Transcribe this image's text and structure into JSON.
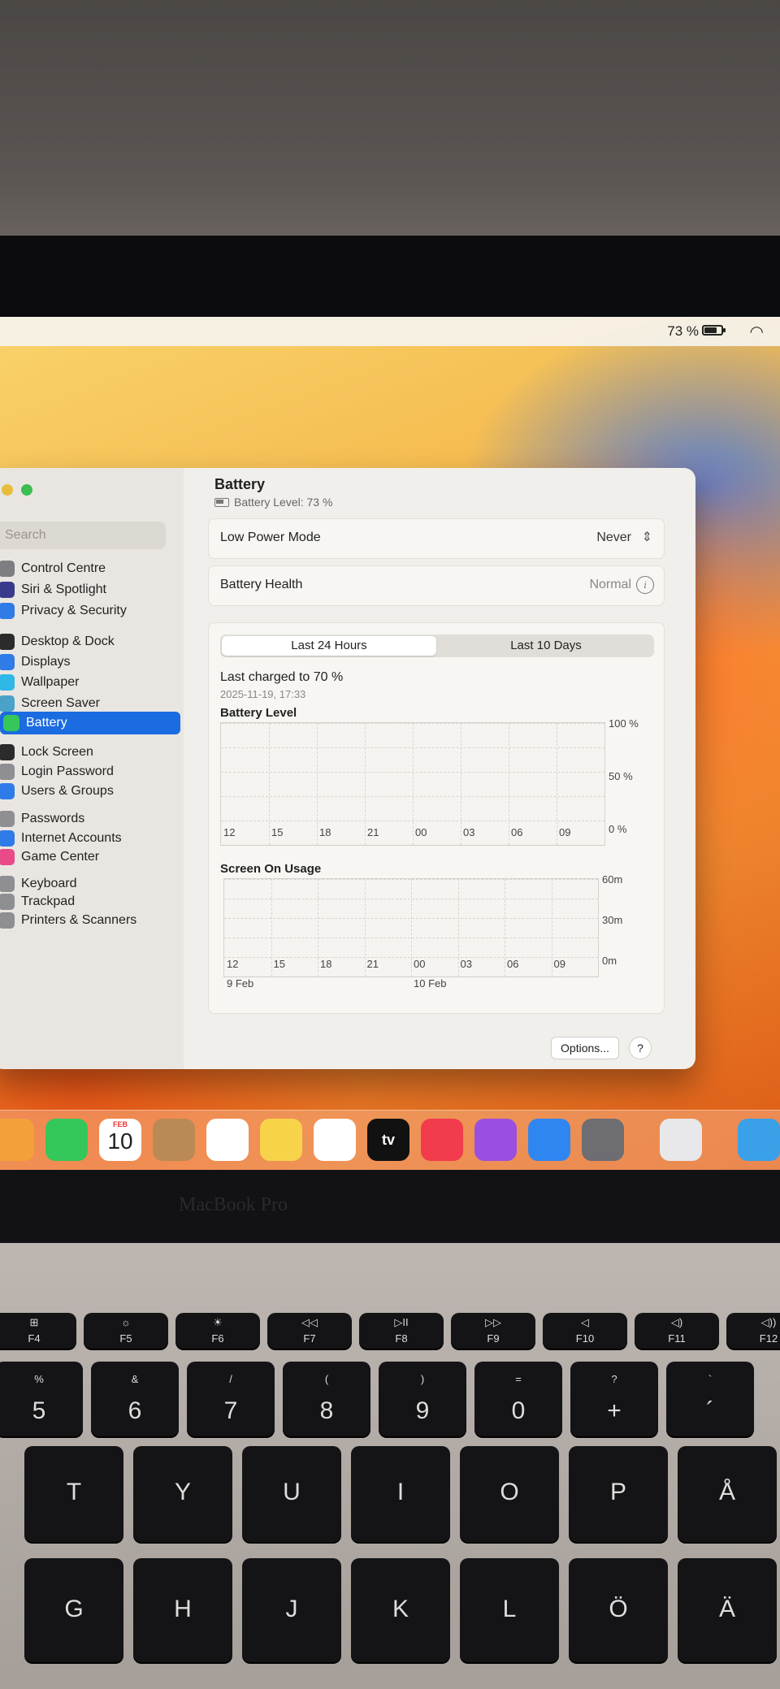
{
  "menubar": {
    "battery_percent": "73 %",
    "battery_icon": "battery-icon",
    "wifi_icon": "wifi-icon"
  },
  "sidebar": {
    "search_placeholder": "Search",
    "items": [
      {
        "label": "Control Centre",
        "icon": "control-centre-icon",
        "color": "#7d7d82"
      },
      {
        "label": "Siri & Spotlight",
        "icon": "siri-icon",
        "color": "#3a3a8c"
      },
      {
        "label": "Privacy & Security",
        "icon": "hand-icon",
        "color": "#2f7be8"
      },
      {
        "label": "Desktop & Dock",
        "icon": "dock-icon",
        "color": "#2b2b2b"
      },
      {
        "label": "Displays",
        "icon": "display-icon",
        "color": "#2f7be8"
      },
      {
        "label": "Wallpaper",
        "icon": "wallpaper-icon",
        "color": "#2fb7e8"
      },
      {
        "label": "Screen Saver",
        "icon": "screen-saver-icon",
        "color": "#49a3c9"
      },
      {
        "label": "Battery",
        "icon": "battery-icon",
        "color": "#35c759"
      },
      {
        "label": "Lock Screen",
        "icon": "lock-icon",
        "color": "#2b2b2b"
      },
      {
        "label": "Login Password",
        "icon": "key-icon",
        "color": "#8e8e93"
      },
      {
        "label": "Users & Groups",
        "icon": "users-icon",
        "color": "#2f7be8"
      },
      {
        "label": "Passwords",
        "icon": "key-icon",
        "color": "#8e8e93"
      },
      {
        "label": "Internet Accounts",
        "icon": "at-icon",
        "color": "#2f7be8"
      },
      {
        "label": "Game Center",
        "icon": "game-center-icon",
        "color": "#e84a8a"
      },
      {
        "label": "Keyboard",
        "icon": "keyboard-icon",
        "color": "#8e8e93"
      },
      {
        "label": "Trackpad",
        "icon": "trackpad-icon",
        "color": "#8e8e93"
      },
      {
        "label": "Printers & Scanners",
        "icon": "printer-icon",
        "color": "#8e8e93"
      }
    ]
  },
  "main": {
    "title": "Battery",
    "subtitle": "Battery Level: 73 %",
    "low_power_label": "Low Power Mode",
    "low_power_value": "Never",
    "health_label": "Battery Health",
    "health_value": "Normal",
    "tab_24h": "Last 24 Hours",
    "tab_10d": "Last 10 Days",
    "last_charged": "Last charged to 70 %",
    "last_charged_time": "2025-11-19, 17:33",
    "options_label": "Options...",
    "help_label": "?"
  },
  "chart_data": [
    {
      "type": "bar",
      "title": "Battery Level",
      "categories": [
        "12",
        "15",
        "18",
        "21",
        "00",
        "03",
        "06",
        "09"
      ],
      "y_ticks": [
        "100 %",
        "50 %",
        "0 %"
      ],
      "values": [],
      "ylim": [
        0,
        100
      ]
    },
    {
      "type": "bar",
      "title": "Screen On Usage",
      "categories": [
        "12",
        "15",
        "18",
        "21",
        "00",
        "03",
        "06",
        "09"
      ],
      "date_labels": [
        "9 Feb",
        "10 Feb"
      ],
      "y_ticks": [
        "60m",
        "30m",
        "0m"
      ],
      "values": [],
      "ylim": [
        0,
        60
      ]
    }
  ],
  "dock": {
    "calendar_month": "FEB",
    "calendar_day": "10",
    "apps": [
      "photos-icon",
      "facetime-icon",
      "calendar-icon",
      "contacts-icon",
      "reminders-icon",
      "notes-icon",
      "freeform-icon",
      "apple-tv-icon",
      "music-icon",
      "podcasts-icon",
      "app-store-icon",
      "system-settings-icon",
      "installer-icon",
      "finder-folder-icon"
    ],
    "tv_label": "tv"
  },
  "laptop": {
    "brand": "MacBook Pro"
  },
  "keyboard": {
    "fn_row": [
      {
        "glyph": "⊞",
        "label": "F4"
      },
      {
        "glyph": "☼",
        "label": "F5"
      },
      {
        "glyph": "☀",
        "label": "F6"
      },
      {
        "glyph": "◁◁",
        "label": "F7"
      },
      {
        "glyph": "▷II",
        "label": "F8"
      },
      {
        "glyph": "▷▷",
        "label": "F9"
      },
      {
        "glyph": "◁",
        "label": "F10"
      },
      {
        "glyph": "◁)",
        "label": "F11"
      },
      {
        "glyph": "◁))",
        "label": "F12"
      }
    ],
    "num_row": [
      {
        "top": "%",
        "bottom": "5"
      },
      {
        "top": "&",
        "bottom": "6"
      },
      {
        "top": "/",
        "bottom": "7"
      },
      {
        "top": "(",
        "bottom": "8"
      },
      {
        "top": ")",
        "bottom": "9"
      },
      {
        "top": "=",
        "bottom": "0"
      },
      {
        "top": "?",
        "bottom": "+"
      },
      {
        "top": "`",
        "bottom": "´"
      }
    ],
    "top_row": [
      "T",
      "Y",
      "U",
      "I",
      "O",
      "P",
      "Å"
    ],
    "home_row": [
      "G",
      "H",
      "J",
      "K",
      "L",
      "Ö",
      "Ä"
    ]
  }
}
